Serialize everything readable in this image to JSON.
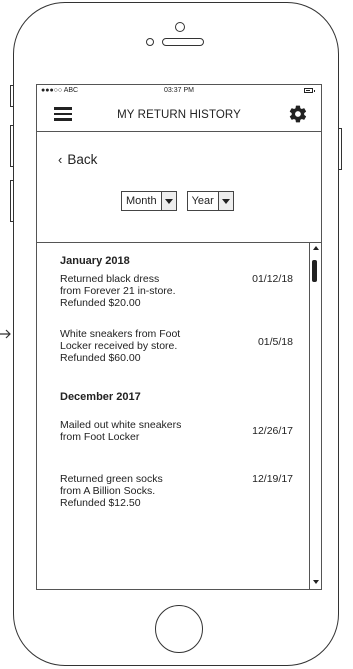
{
  "statusbar": {
    "carrier": "●●●○○ ABC",
    "time": "03:37 PM"
  },
  "navbar": {
    "title": "MY RETURN HISTORY"
  },
  "back": {
    "label": "Back"
  },
  "filters": {
    "month": "Month",
    "year": "Year"
  },
  "history": {
    "groups": [
      {
        "heading": "January 2018",
        "entries": [
          {
            "lines": [
              "Returned black dress",
              "from Forever 21 in-store.",
              "Refunded $20.00"
            ],
            "date": "01/12/18"
          },
          {
            "lines": [
              "White sneakers from Foot",
              "Locker received by store.",
              "Refunded $60.00"
            ],
            "date": "01/5/18"
          }
        ]
      },
      {
        "heading": "December 2017",
        "entries": [
          {
            "lines": [
              "Mailed out white sneakers",
              "from Foot Locker"
            ],
            "date": "12/26/17"
          },
          {
            "lines": [
              "Returned green socks",
              "from A Billion Socks.",
              "Refunded $12.50"
            ],
            "date": "12/19/17"
          }
        ]
      }
    ]
  }
}
